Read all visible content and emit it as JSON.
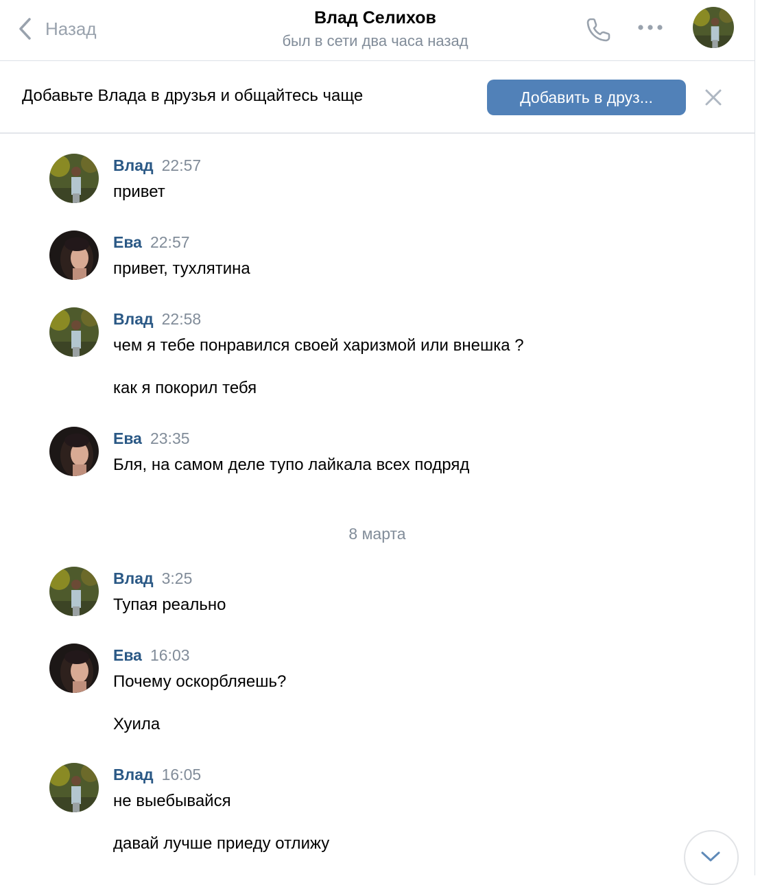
{
  "header": {
    "back_label": "Назад",
    "title": "Влад Селихов",
    "status": "был в сети два часа назад"
  },
  "banner": {
    "text": "Добавьте Влада в друзья и общайтесь чаще",
    "button_label": "Добавить в друз..."
  },
  "messages": [
    {
      "author": "Влад",
      "time": "22:57",
      "lines": [
        "привет"
      ]
    },
    {
      "author": "Ева",
      "time": "22:57",
      "lines": [
        "привет, тухлятина"
      ]
    },
    {
      "author": "Влад",
      "time": "22:58",
      "lines": [
        "чем я тебе понравился своей харизмой или внешка ?",
        "как я покорил тебя"
      ]
    },
    {
      "author": "Ева",
      "time": "23:35",
      "lines": [
        "Бля, на самом деле тупо лайкала всех подряд"
      ]
    },
    {
      "author": "Влад",
      "time": "3:25",
      "lines": [
        "Тупая реально"
      ]
    },
    {
      "author": "Ева",
      "time": "16:03",
      "lines": [
        "Почему оскорбляешь?",
        "Хуила"
      ]
    },
    {
      "author": "Влад",
      "time": "16:05",
      "lines": [
        "не выебывайся",
        "давай лучше приеду отлижу"
      ]
    }
  ],
  "date_separator": "8 марта",
  "colors": {
    "accent": "#5181b8",
    "author_link": "#2a5885",
    "secondary_text": "#818c99"
  }
}
